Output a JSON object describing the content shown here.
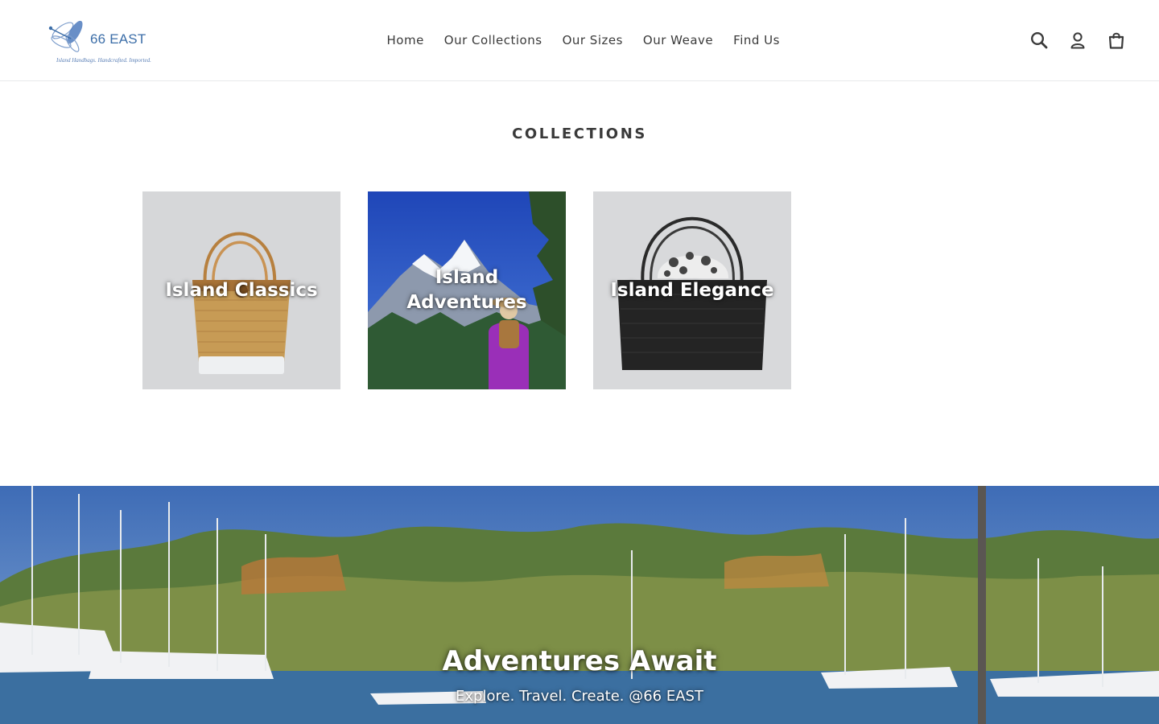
{
  "brand": {
    "name": "66 EAST",
    "tagline": "Island Handbags. Handcrafted. Imported.",
    "logo_color": "#3c6ea8"
  },
  "nav": {
    "items": [
      {
        "label": "Home"
      },
      {
        "label": "Our Collections"
      },
      {
        "label": "Our Sizes"
      },
      {
        "label": "Our Weave"
      },
      {
        "label": "Find Us"
      }
    ]
  },
  "header_icons": {
    "search": "search-icon",
    "account": "account-icon",
    "cart": "cart-icon"
  },
  "collections": {
    "title": "COLLECTIONS",
    "items": [
      {
        "title": "Island Classics",
        "image": "rattan-handbag-natural"
      },
      {
        "title": "Island Adventures",
        "image": "hiker-with-rattan-backpack-mountains"
      },
      {
        "title": "Island Elegance",
        "image": "black-rattan-handbag-floral-lining"
      }
    ]
  },
  "hero": {
    "heading": "Adventures Await",
    "subheading": "Explore. Travel. Create. @66 EAST",
    "image": "marina-sailboats"
  },
  "colors": {
    "text": "#3a3a3a",
    "border": "#e8e9eb",
    "overlay_text": "#ffffff"
  }
}
